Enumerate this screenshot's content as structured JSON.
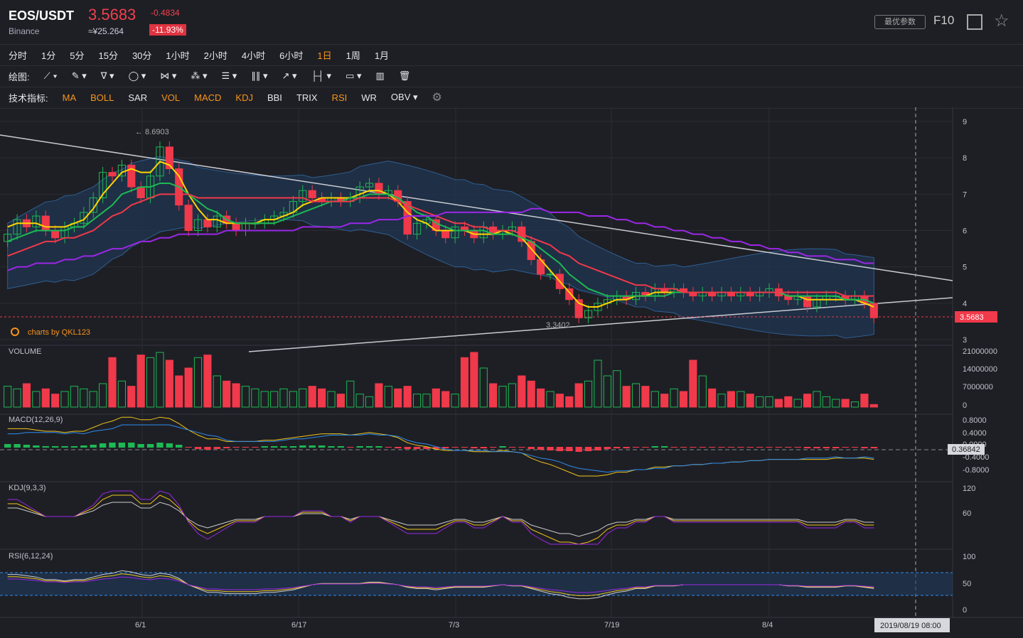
{
  "header": {
    "pair": "EOS/USDT",
    "exchange": "Binance",
    "price": "3.5683",
    "cny": "≈¥25.264",
    "change": "-0.4834",
    "change_pct": "-11.93%",
    "opt_button": "最优参数",
    "f10": "F10"
  },
  "toolbar": {
    "periods": [
      "分时",
      "1分",
      "5分",
      "15分",
      "30分",
      "1小时",
      "2小时",
      "4小时",
      "6小时",
      "1日",
      "1周",
      "1月"
    ],
    "active_period": "1日",
    "draw_label": "绘图:",
    "ind_label": "技术指标:",
    "indicators": [
      "MA",
      "BOLL",
      "SAR",
      "VOL",
      "MACD",
      "KDJ",
      "BBI",
      "TRIX",
      "RSI",
      "WR",
      "OBV"
    ],
    "active_indicators": [
      "MA",
      "BOLL",
      "VOL",
      "MACD",
      "KDJ",
      "RSI"
    ]
  },
  "chart_data": {
    "type": "candlestick",
    "title": "",
    "watermark": "charts by QKL123",
    "price_axis": {
      "ticks": [
        "9",
        "8",
        "7",
        "6",
        "5",
        "4",
        "3"
      ],
      "range": [
        3,
        9
      ]
    },
    "high_label": "8.6903",
    "low_label": "3.3402",
    "last_price_label": "3.5683",
    "x_ticks": [
      "6/1",
      "6/17",
      "7/3",
      "7/19",
      "8/4"
    ],
    "crosshair_label": "2019/08/19 08:00",
    "volume": {
      "label": "VOLUME",
      "ticks": [
        "21000000",
        "14000000",
        "7000000",
        "0"
      ]
    },
    "macd": {
      "label": "MACD(12,26,9)",
      "ticks": [
        "0.8000",
        "0.4000",
        "0.0000",
        "-0.4000",
        "-0.8000"
      ],
      "value_label": "0.36842"
    },
    "kdj": {
      "label": "KDJ(9,3,3)",
      "ticks": [
        "120",
        "60"
      ]
    },
    "rsi": {
      "label": "RSI(6,12,24)",
      "ticks": [
        "100",
        "50",
        "0"
      ]
    },
    "closes": [
      5.9,
      6.3,
      6.1,
      6.4,
      6.0,
      5.8,
      6.1,
      6.2,
      6.5,
      6.9,
      7.6,
      7.5,
      7.8,
      7.2,
      6.9,
      7.5,
      8.3,
      7.7,
      6.7,
      6.0,
      6.3,
      6.1,
      6.4,
      6.2,
      6.0,
      6.2,
      6.2,
      6.3,
      6.4,
      6.5,
      6.8,
      7.1,
      6.9,
      6.8,
      6.9,
      6.8,
      6.9,
      7.2,
      7.3,
      7.0,
      7.1,
      6.8,
      5.9,
      6.2,
      6.3,
      6.0,
      5.8,
      6.1,
      6.0,
      5.8,
      6.1,
      5.9,
      6.0,
      6.1,
      5.7,
      5.2,
      4.8,
      4.8,
      4.4,
      4.1,
      3.6,
      3.8,
      4.0,
      4.1,
      4.2,
      4.1,
      4.3,
      4.2,
      4.4,
      4.3,
      4.4,
      4.3,
      4.2,
      4.3,
      4.2,
      4.3,
      4.2,
      4.3,
      4.2,
      4.3,
      4.4,
      4.2,
      4.1,
      4.2,
      3.9,
      4.1,
      4.2,
      4.2,
      4.1,
      4.2,
      4.0,
      3.6
    ],
    "ma_lines": [
      {
        "color": "#ffd400",
        "values": [
          6.1,
          6.2,
          6.2,
          6.2,
          6.1,
          6.1,
          6.1,
          6.2,
          6.3,
          6.6,
          7.0,
          7.3,
          7.6,
          7.7,
          7.6,
          7.6,
          7.9,
          7.8,
          7.5,
          7.0,
          6.6,
          6.3,
          6.3,
          6.2,
          6.2,
          6.2,
          6.2,
          6.3,
          6.3,
          6.4,
          6.5,
          6.7,
          6.8,
          6.9,
          6.9,
          6.9,
          6.9,
          7.0,
          7.1,
          7.1,
          7.0,
          6.8,
          6.5,
          6.3,
          6.2,
          6.0,
          6.0,
          6.0,
          6.0,
          5.9,
          5.9,
          5.9,
          6.0,
          5.9,
          5.8,
          5.5,
          5.2,
          4.9,
          4.6,
          4.3,
          4.0,
          3.9,
          3.9,
          4.0,
          4.1,
          4.1,
          4.2,
          4.2,
          4.3,
          4.3,
          4.3,
          4.3,
          4.3,
          4.3,
          4.3,
          4.3,
          4.3,
          4.3,
          4.3,
          4.3,
          4.3,
          4.3,
          4.2,
          4.2,
          4.1,
          4.1,
          4.1,
          4.1,
          4.1,
          4.1,
          4.0,
          3.9
        ]
      },
      {
        "color": "#1db954",
        "values": [
          5.7,
          5.8,
          5.9,
          6.0,
          6.0,
          6.0,
          6.0,
          6.1,
          6.1,
          6.3,
          6.5,
          6.7,
          7.0,
          7.1,
          7.2,
          7.2,
          7.3,
          7.3,
          7.2,
          7.0,
          6.8,
          6.6,
          6.5,
          6.3,
          6.2,
          6.2,
          6.2,
          6.2,
          6.2,
          6.3,
          6.4,
          6.5,
          6.6,
          6.7,
          6.8,
          6.8,
          6.9,
          6.9,
          7.0,
          7.0,
          7.0,
          6.9,
          6.7,
          6.5,
          6.4,
          6.2,
          6.1,
          6.0,
          6.0,
          6.0,
          6.0,
          5.9,
          5.9,
          5.9,
          5.8,
          5.7,
          5.5,
          5.3,
          5.1,
          4.8,
          4.6,
          4.4,
          4.3,
          4.2,
          4.2,
          4.2,
          4.2,
          4.2,
          4.2,
          4.2,
          4.3,
          4.3,
          4.3,
          4.3,
          4.3,
          4.3,
          4.3,
          4.3,
          4.3,
          4.3,
          4.3,
          4.3,
          4.2,
          4.2,
          4.2,
          4.2,
          4.2,
          4.2,
          4.1,
          4.1,
          4.1,
          4.0
        ]
      },
      {
        "color": "#f0394a",
        "values": [
          5.3,
          5.4,
          5.5,
          5.6,
          5.7,
          5.7,
          5.8,
          5.8,
          5.9,
          6.0,
          6.2,
          6.4,
          6.5,
          6.7,
          6.8,
          6.9,
          7.0,
          7.0,
          7.0,
          7.0,
          6.9,
          6.9,
          6.9,
          6.9,
          6.9,
          6.9,
          6.9,
          6.9,
          6.9,
          6.9,
          6.9,
          6.9,
          6.8,
          6.8,
          6.8,
          6.8,
          6.8,
          6.9,
          6.9,
          6.9,
          6.9,
          6.8,
          6.7,
          6.6,
          6.5,
          6.4,
          6.3,
          6.2,
          6.2,
          6.1,
          6.1,
          6.0,
          6.0,
          6.0,
          5.9,
          5.8,
          5.7,
          5.6,
          5.4,
          5.3,
          5.1,
          5.0,
          4.9,
          4.8,
          4.7,
          4.6,
          4.5,
          4.5,
          4.4,
          4.4,
          4.4,
          4.3,
          4.3,
          4.3,
          4.3,
          4.3,
          4.3,
          4.3,
          4.3,
          4.3,
          4.3,
          4.3,
          4.3,
          4.3,
          4.3,
          4.3,
          4.3,
          4.3,
          4.2,
          4.2,
          4.2,
          4.2
        ]
      },
      {
        "color": "#9b27e6",
        "values": [
          4.9,
          5.0,
          5.0,
          5.1,
          5.1,
          5.1,
          5.2,
          5.2,
          5.3,
          5.3,
          5.4,
          5.5,
          5.5,
          5.6,
          5.7,
          5.7,
          5.8,
          5.8,
          5.9,
          5.9,
          5.9,
          5.9,
          5.9,
          6.0,
          6.0,
          6.0,
          6.0,
          6.0,
          6.0,
          6.0,
          6.0,
          6.1,
          6.1,
          6.1,
          6.1,
          6.1,
          6.2,
          6.2,
          6.2,
          6.3,
          6.3,
          6.3,
          6.4,
          6.4,
          6.4,
          6.4,
          6.5,
          6.5,
          6.5,
          6.5,
          6.5,
          6.5,
          6.5,
          6.5,
          6.5,
          6.6,
          6.6,
          6.5,
          6.5,
          6.5,
          6.5,
          6.4,
          6.4,
          6.4,
          6.3,
          6.3,
          6.2,
          6.2,
          6.1,
          6.1,
          6.0,
          6.0,
          5.9,
          5.9,
          5.8,
          5.8,
          5.7,
          5.7,
          5.6,
          5.6,
          5.5,
          5.5,
          5.4,
          5.4,
          5.3,
          5.3,
          5.3,
          5.2,
          5.2,
          5.2,
          5.1,
          5.1
        ]
      }
    ],
    "volumes": [
      8,
      7,
      9,
      6,
      7,
      5,
      6,
      8,
      7,
      6,
      9,
      19,
      10,
      8,
      20,
      19,
      21,
      18,
      12,
      15,
      19,
      20,
      12,
      10,
      9,
      8,
      7,
      6,
      6,
      7,
      6,
      7,
      8,
      7,
      6,
      5,
      10,
      5,
      4,
      9,
      8,
      7,
      8,
      5,
      5,
      7,
      6,
      5,
      19,
      21,
      15,
      9,
      8,
      9,
      12,
      10,
      7,
      6,
      5,
      4,
      9,
      10,
      18,
      12,
      14,
      8,
      9,
      8,
      6,
      5,
      7,
      6,
      18,
      12,
      7,
      5,
      6,
      6,
      5,
      4,
      4,
      3,
      4,
      3,
      5,
      6,
      4,
      3,
      3,
      2,
      5,
      1
    ]
  }
}
